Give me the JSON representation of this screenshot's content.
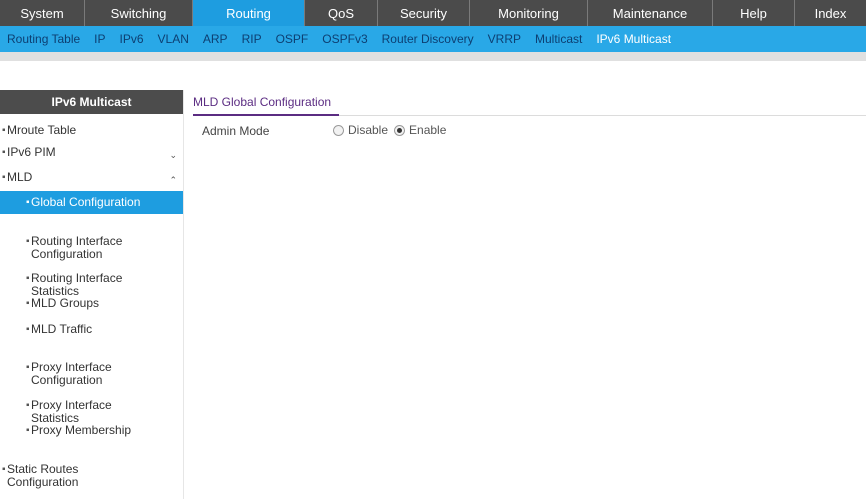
{
  "topnav": {
    "tabs": [
      {
        "label": "System"
      },
      {
        "label": "Switching"
      },
      {
        "label": "Routing"
      },
      {
        "label": "QoS"
      },
      {
        "label": "Security"
      },
      {
        "label": "Monitoring"
      },
      {
        "label": "Maintenance"
      },
      {
        "label": "Help"
      },
      {
        "label": "Index"
      }
    ],
    "active": "Routing"
  },
  "subnav": {
    "items": [
      {
        "label": "Routing Table"
      },
      {
        "label": "IP"
      },
      {
        "label": "IPv6"
      },
      {
        "label": "VLAN"
      },
      {
        "label": "ARP"
      },
      {
        "label": "RIP"
      },
      {
        "label": "OSPF"
      },
      {
        "label": "OSPFv3"
      },
      {
        "label": "Router Discovery"
      },
      {
        "label": "VRRP"
      },
      {
        "label": "Multicast"
      },
      {
        "label": "IPv6 Multicast"
      }
    ],
    "active": "IPv6 Multicast"
  },
  "sidebar": {
    "header": "IPv6 Multicast",
    "items": [
      {
        "label": "Mroute Table"
      },
      {
        "label": "IPv6 PIM"
      },
      {
        "label": "MLD"
      },
      {
        "label": "Global Configuration"
      },
      {
        "label": "Routing Interface\nConfiguration"
      },
      {
        "label": "Routing Interface\nStatistics"
      },
      {
        "label": "MLD Groups"
      },
      {
        "label": "MLD Traffic"
      },
      {
        "label": "Proxy Interface\nConfiguration"
      },
      {
        "label": "Proxy Interface\nStatistics"
      },
      {
        "label": "Proxy Membership"
      },
      {
        "label": "Static Routes\nConfiguration"
      }
    ]
  },
  "main": {
    "title": "MLD Global Configuration",
    "admin_mode": {
      "label": "Admin Mode",
      "options": [
        {
          "label": "Disable",
          "selected": false
        },
        {
          "label": "Enable",
          "selected": true
        }
      ]
    }
  },
  "colors": {
    "accent": "#1e9de0",
    "nav_dark": "#4b4b4b",
    "subnav_bar": "#29a8e7",
    "title_purple": "#5b2c82"
  }
}
